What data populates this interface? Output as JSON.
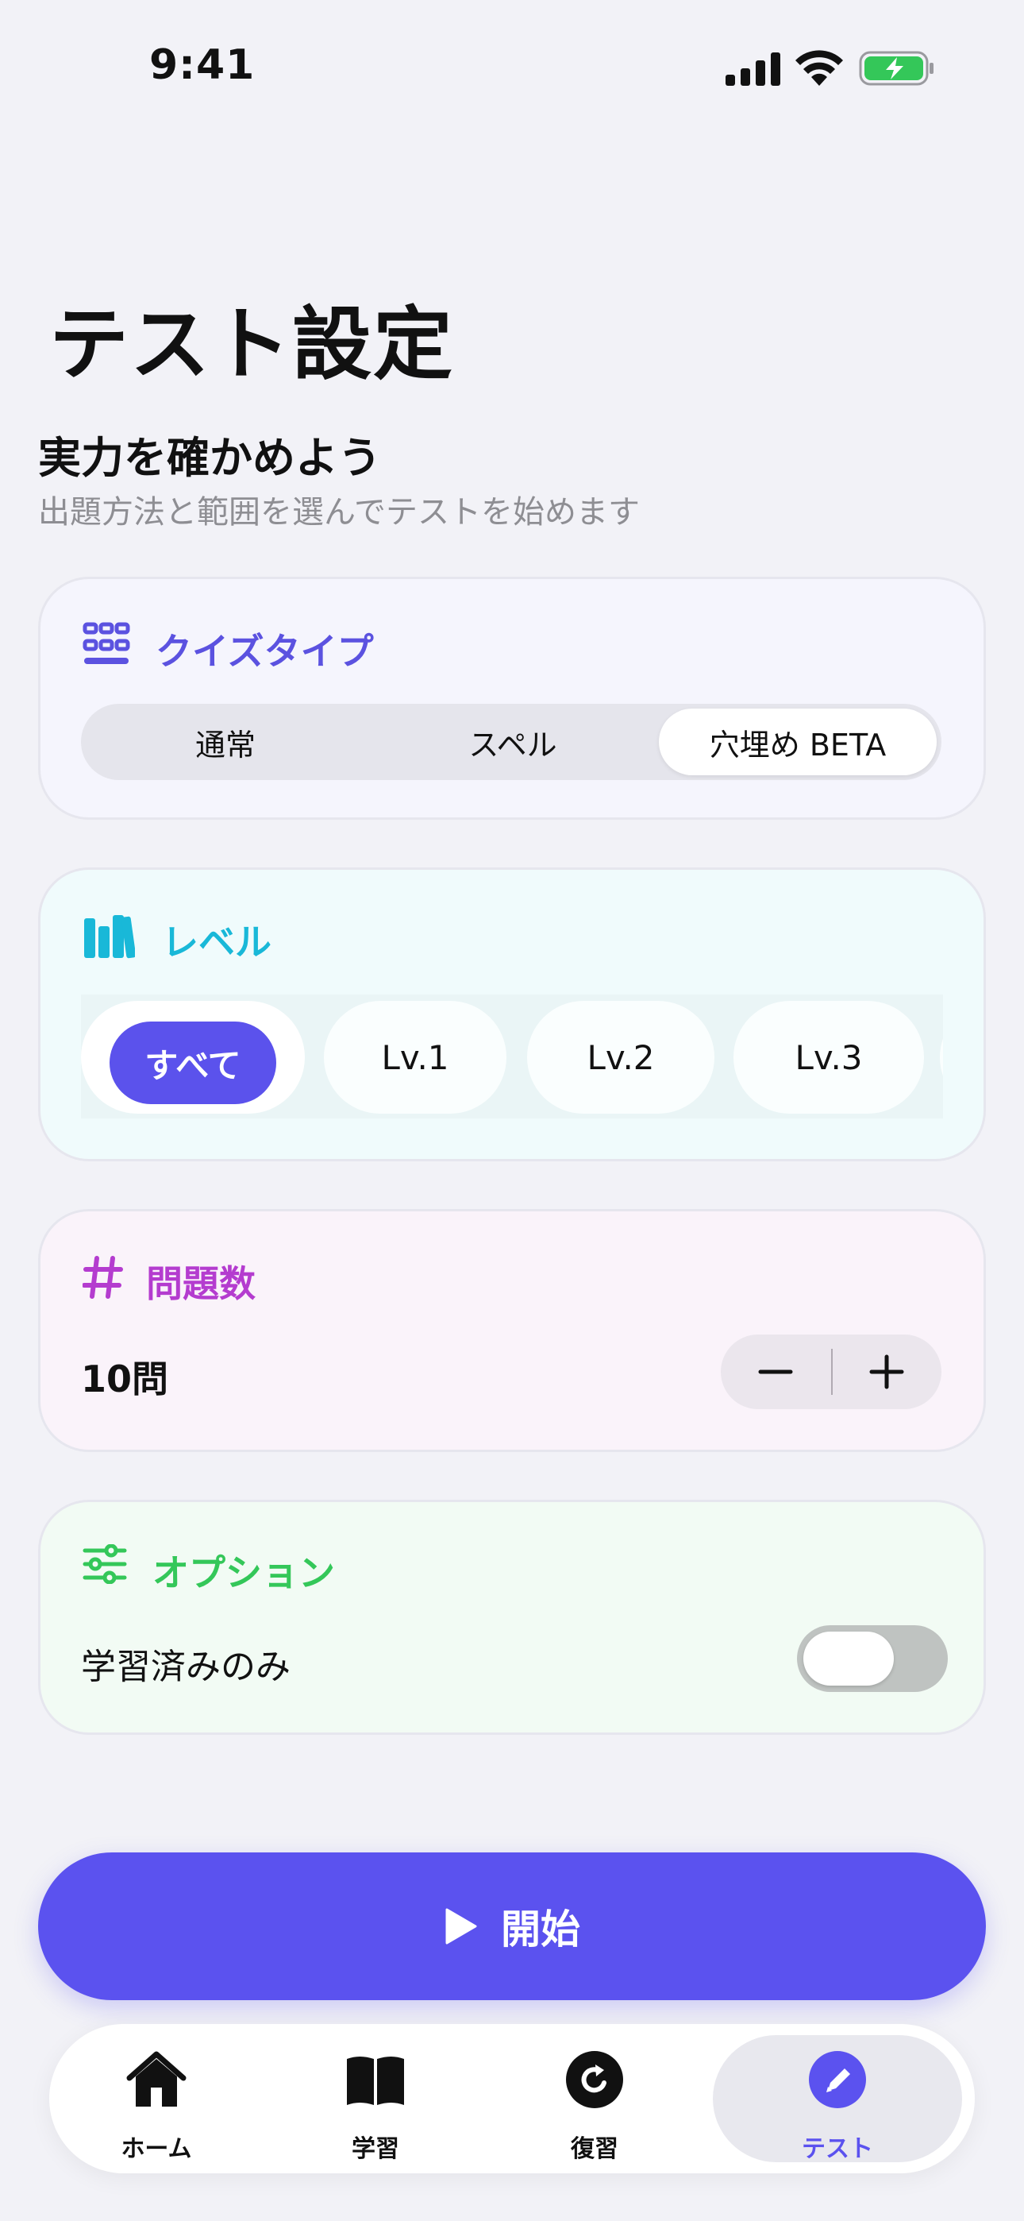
{
  "status_bar": {
    "time": "9:41"
  },
  "header": {
    "title": "テスト設定",
    "subtitle": "実力を確かめよう",
    "description": "出題方法と範囲を選んでテストを始めます"
  },
  "quiz_type": {
    "title": "クイズタイプ",
    "icon": "grid-icon",
    "options": [
      "通常",
      "スペル",
      "穴埋め BETA"
    ],
    "selected": "穴埋め BETA"
  },
  "level": {
    "title": "レベル",
    "icon": "books-icon",
    "chips": [
      "すべて",
      "Lv.1",
      "Lv.2",
      "Lv.3"
    ],
    "selected": "すべて"
  },
  "question_count": {
    "title": "問題数",
    "icon": "hash-icon",
    "value": "10問",
    "decrement": "−",
    "increment": "+"
  },
  "options": {
    "title": "オプション",
    "icon": "sliders-icon",
    "learned_only_label": "学習済みのみ",
    "learned_only": false
  },
  "start_button": {
    "label": "開始",
    "icon": "play-icon"
  },
  "tab_bar": {
    "items": [
      {
        "label": "ホーム",
        "icon": "house-icon"
      },
      {
        "label": "学習",
        "icon": "book-icon"
      },
      {
        "label": "復習",
        "icon": "refresh-icon"
      },
      {
        "label": "テスト",
        "icon": "pencil-icon"
      }
    ],
    "active": "テスト"
  },
  "colors": {
    "accent": "#5b52ef",
    "quiz_title": "#5b52e0",
    "level_title": "#19b8d8",
    "count_title": "#b43ccf",
    "option_title": "#34c759"
  }
}
